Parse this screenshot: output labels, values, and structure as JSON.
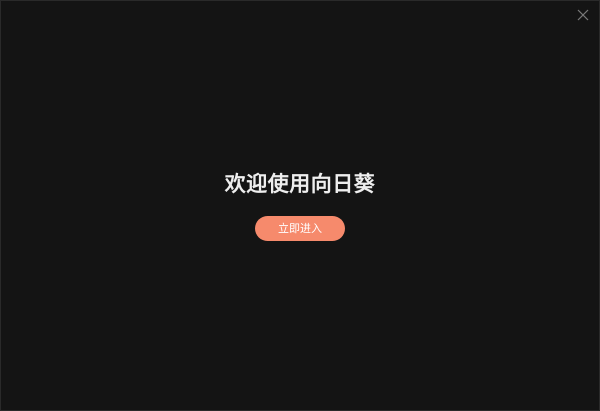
{
  "window": {
    "close_icon": "close-icon"
  },
  "welcome": {
    "title": "欢迎使用向日葵",
    "enter_label": "立即进入"
  },
  "colors": {
    "background": "#141414",
    "title_text": "#eeeeee",
    "accent": "#f68a6c",
    "close_icon": "#7a7a7a"
  }
}
